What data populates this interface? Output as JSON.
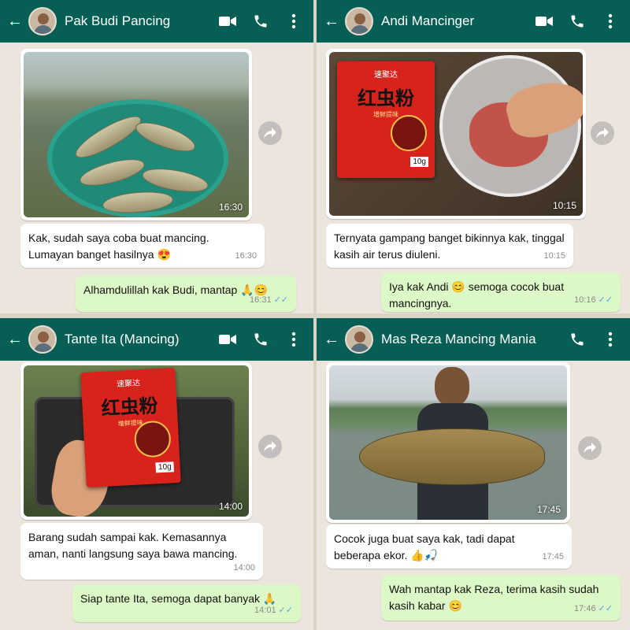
{
  "panels": [
    {
      "contact": "Pak Budi Pancing",
      "icons": [
        "back-arrow-icon",
        "video-call-icon",
        "phone-icon",
        "more-vert-icon"
      ],
      "photo_time": "16:30",
      "messages": [
        {
          "dir": "in",
          "text": "Kak, sudah saya coba buat mancing. Lumayan banget hasilnya 😍",
          "time": "16:30"
        },
        {
          "dir": "out",
          "text": "Alhamdulillah kak Budi, mantap 🙏😊",
          "time": "16:31",
          "ticks": "✓✓"
        }
      ]
    },
    {
      "contact": "Andi Mancinger",
      "icons": [
        "back-arrow-icon",
        "video-call-icon",
        "phone-icon",
        "more-vert-icon"
      ],
      "photo_time": "10:15",
      "messages": [
        {
          "dir": "in",
          "text": "Ternyata gampang banget bikinnya kak, tinggal kasih air terus diuleni.",
          "time": "10:15"
        },
        {
          "dir": "out",
          "text": "Iya kak Andi 😊 semoga cocok buat mancingnya.",
          "time": "10:16",
          "ticks": "✓✓"
        }
      ]
    },
    {
      "contact": "Tante Ita (Mancing)",
      "icons": [
        "back-arrow-icon",
        "video-call-icon",
        "phone-icon",
        "more-vert-icon"
      ],
      "photo_time": "14:00",
      "messages": [
        {
          "dir": "in",
          "text": "Barang sudah sampai kak. Kemasannya aman, nanti langsung saya bawa mancing.",
          "time": "14:00"
        },
        {
          "dir": "out",
          "text": "Siap tante Ita, semoga dapat banyak 🙏",
          "time": "14:01",
          "ticks": "✓✓"
        }
      ]
    },
    {
      "contact": "Mas Reza Mancing Mania",
      "icons": [
        "back-arrow-icon",
        "phone-icon",
        "more-vert-icon"
      ],
      "photo_time": "17:45",
      "messages": [
        {
          "dir": "in",
          "text": "Cocok juga buat saya kak, tadi dapat beberapa ekor. 👍🎣",
          "time": "17:45"
        },
        {
          "dir": "out",
          "text": "Wah mantap kak Reza, terima kasih sudah kasih kabar 😊",
          "time": "17:46",
          "ticks": "✓✓"
        }
      ]
    }
  ],
  "product": {
    "brand": "速聚达",
    "name": "红虫粉",
    "subtitle": "增鲜提味",
    "weight": "10g"
  },
  "colors": {
    "header": "#075e54",
    "chat_bg": "#ece5dd",
    "bubble_out": "#dcf8c6",
    "bubble_in": "#ffffff",
    "tick_read": "#4fa3e0"
  }
}
